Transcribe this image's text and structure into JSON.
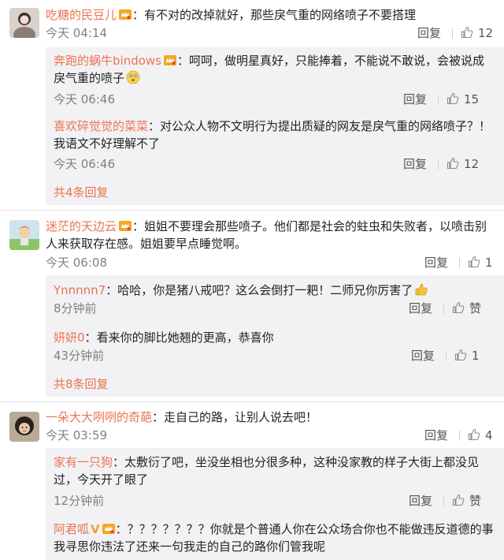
{
  "ui": {
    "reply_label": "回复",
    "praise_label": "赞",
    "separator": "：",
    "accent": "#eb7350"
  },
  "threads": [
    {
      "user": "吃糖的民豆儿",
      "text": "有不对的改掉就好，那些戾气重的网络喷子不要搭理",
      "time": "今天 04:14",
      "likes": "12",
      "replies": [
        {
          "user": "奔跑的蜗牛bindows",
          "text": "呵呵，做明星真好，只能捧着，不能说不敢说，会被说成戾气重的喷子",
          "time": "今天 06:46",
          "likes": "15"
        },
        {
          "user": "喜欢碎觉觉的菜菜",
          "text": "对公众人物不文明行为提出质疑的网友是戾气重的网络喷子？！我语文不好理解不了",
          "time": "今天 06:46",
          "likes": "12"
        }
      ],
      "more": "共4条回复"
    },
    {
      "user": "迷茫的天边云",
      "text": "姐姐不要理会那些喷子。他们都是社会的蛀虫和失败者，以喷击别人来获取存在感。姐姐要早点睡觉啊。",
      "time": "今天 06:08",
      "likes": "1",
      "replies": [
        {
          "user": "Ynnnnn7",
          "text": "哈哈，你是猪八戒吧？这么会倒打一耙！二师兄你厉害了",
          "time": "8分钟前",
          "likes": "赞"
        },
        {
          "user": "妍妍0",
          "text": "看来你的脚比她翘的更高，恭喜你",
          "time": "43分钟前",
          "likes": "1"
        }
      ],
      "more": "共8条回复"
    },
    {
      "user": "一朵大大咧咧的奇葩",
      "text": "走自己的路，让别人说去吧！",
      "time": "今天 03:59",
      "likes": "4",
      "replies": [
        {
          "user": "家有一只狗",
          "text": "太敷衍了吧，坐没坐相也分很多种，这种没家教的样子大街上都没见过，今天开了眼了",
          "time": "12分钟前",
          "likes": "赞"
        },
        {
          "user": "阿君呱",
          "text": "？？？？？？？你就是个普通人你在公众场合你也不能做违反道德的事 我寻思你违法了还来一句我走的自己的路你们管我呢"
        }
      ]
    }
  ]
}
